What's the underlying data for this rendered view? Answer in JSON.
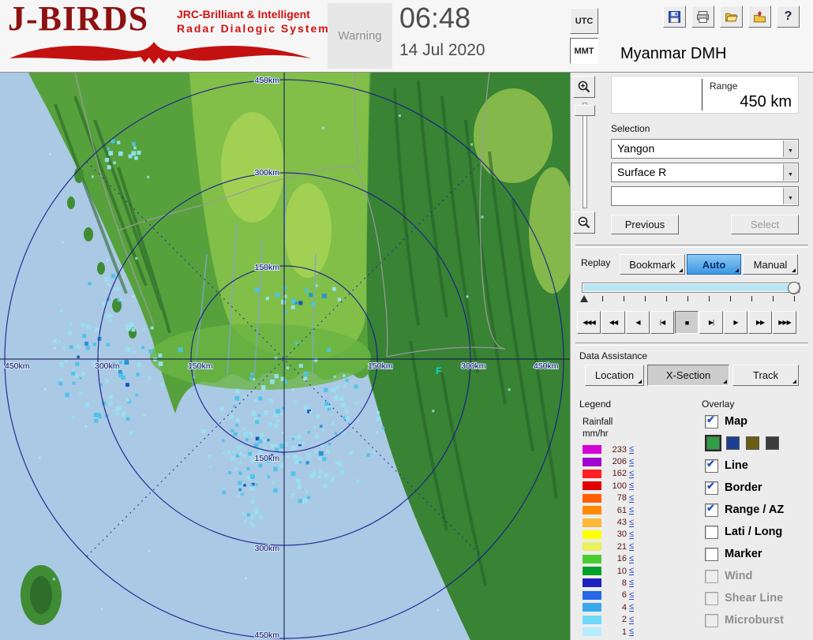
{
  "colors": {
    "brand_red": "#b01212",
    "selection_blue": "#3c97e4",
    "map_ocean": "#aac9e4",
    "map_land": "#57a13d"
  },
  "header": {
    "logo": {
      "title": "J-BIRDS",
      "subtitle1": "JRC-Brilliant & Intelligent",
      "subtitle2": "Radar  Dialogic  System"
    },
    "warning": "Warning",
    "clock": {
      "time": "06:48",
      "date": "14 Jul 2020"
    },
    "timezone": {
      "utc": "UTC",
      "mmt": "MMT",
      "selected": "MMT"
    },
    "station": "Myanmar DMH"
  },
  "toolbar": {
    "icons": [
      "save-icon",
      "print-icon",
      "open-folder-icon",
      "export-folder-icon",
      "help-icon"
    ],
    "help": "?"
  },
  "map": {
    "ring_labels": {
      "r150": "150km",
      "r300": "300km",
      "r450": "450km"
    },
    "marker_f": "F"
  },
  "panel": {
    "range": {
      "label": "Range",
      "value": "450 km"
    },
    "selection": {
      "label": "Selection",
      "site": "Yangon",
      "product": "Surface R",
      "extra": ""
    },
    "buttons": {
      "previous": "Previous",
      "select": "Select"
    },
    "replay": {
      "label": "Replay",
      "bookmark": "Bookmark",
      "auto": "Auto",
      "manual": "Manual"
    },
    "playback": [
      "◀◀◀",
      "◀◀",
      "◀",
      "|◀",
      "■",
      "▶|",
      "▶",
      "▶▶",
      "▶▶▶"
    ],
    "data_assistance": {
      "label": "Data Assistance",
      "location": "Location",
      "xsection": "X-Section",
      "track": "Track"
    },
    "legend": {
      "label": "Legend",
      "unit_line1": "Rainfall",
      "unit_line2": "mm/hr",
      "operator": "≤",
      "rows": [
        {
          "value": "233",
          "color": "#d400d4"
        },
        {
          "value": "206",
          "color": "#a000d0"
        },
        {
          "value": "162",
          "color": "#ff2020"
        },
        {
          "value": "100",
          "color": "#e00000"
        },
        {
          "value": "78",
          "color": "#ff6000"
        },
        {
          "value": "61",
          "color": "#ff8c00"
        },
        {
          "value": "43",
          "color": "#ffb838"
        },
        {
          "value": "30",
          "color": "#ffff00"
        },
        {
          "value": "21",
          "color": "#e8f060"
        },
        {
          "value": "16",
          "color": "#48cc30"
        },
        {
          "value": "10",
          "color": "#00a028"
        },
        {
          "value": "8",
          "color": "#2020c0"
        },
        {
          "value": "6",
          "color": "#2868e8"
        },
        {
          "value": "4",
          "color": "#38a8f0"
        },
        {
          "value": "2",
          "color": "#70d8f8"
        },
        {
          "value": "1",
          "color": "#b8ecfc"
        }
      ]
    },
    "overlay": {
      "label": "Overlay",
      "map_palette": {
        "colors": [
          "#2f9e44",
          "#1c3f94",
          "#6b5d11",
          "#3c3c3c"
        ],
        "selected": 0
      },
      "items": [
        {
          "label": "Map",
          "checked": true,
          "disabled": false
        },
        {
          "label": "Line",
          "checked": true,
          "disabled": false
        },
        {
          "label": "Border",
          "checked": true,
          "disabled": false
        },
        {
          "label": "Range / AZ",
          "checked": true,
          "disabled": false
        },
        {
          "label": "Lati / Long",
          "checked": false,
          "disabled": false
        },
        {
          "label": "Marker",
          "checked": false,
          "disabled": false
        },
        {
          "label": "Wind",
          "checked": false,
          "disabled": true
        },
        {
          "label": "Shear Line",
          "checked": false,
          "disabled": true
        },
        {
          "label": "Microburst",
          "checked": false,
          "disabled": true
        }
      ]
    }
  }
}
